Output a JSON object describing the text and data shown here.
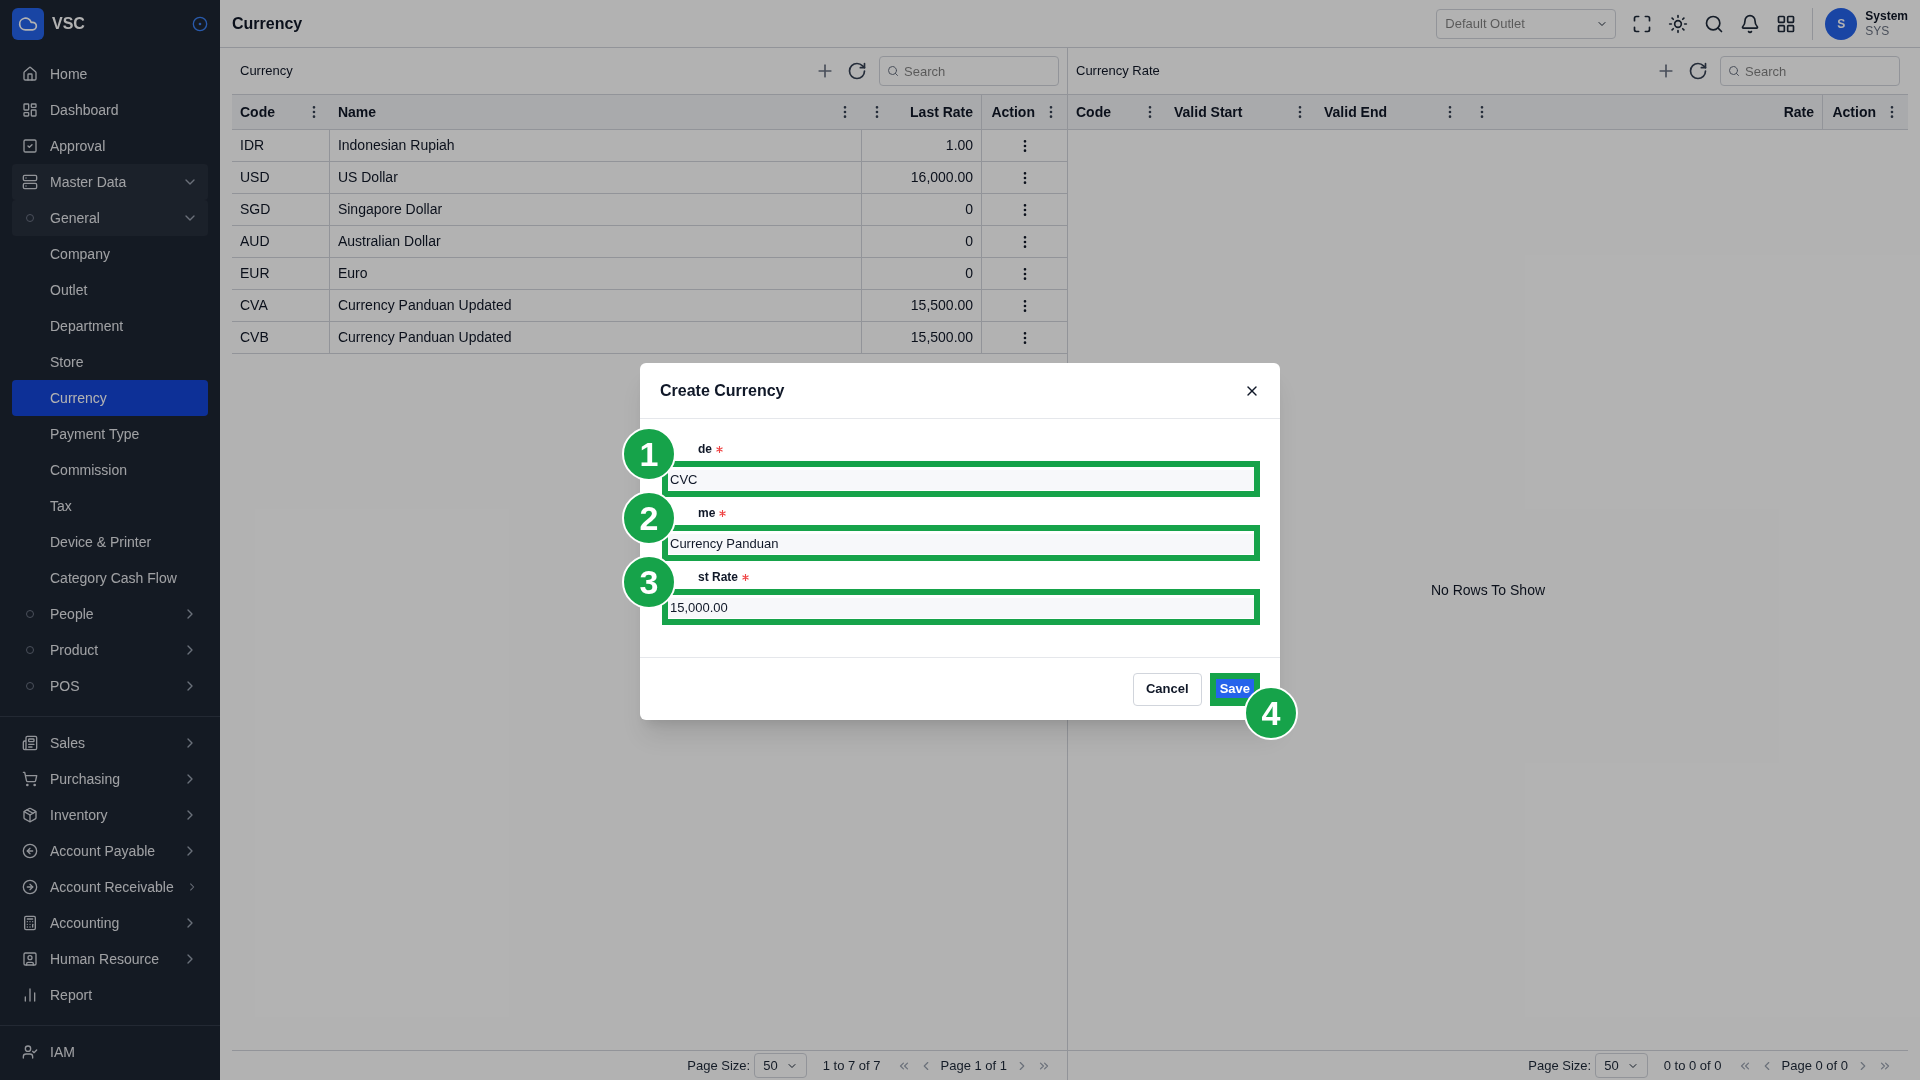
{
  "sidebar": {
    "brand": "VSC",
    "sections": [
      [
        {
          "label": "Home",
          "selected": false
        },
        {
          "label": "Dashboard",
          "selected": false
        },
        {
          "label": "Approval",
          "selected": false
        },
        {
          "label": "Master Data",
          "selected": false,
          "expanded": true,
          "children": [
            {
              "label": "General",
              "selected": false,
              "expanded": true,
              "children": [
                {
                  "label": "Company",
                  "selected": false
                },
                {
                  "label": "Outlet",
                  "selected": false
                },
                {
                  "label": "Department",
                  "selected": false
                },
                {
                  "label": "Store",
                  "selected": false
                },
                {
                  "label": "Currency",
                  "selected": true
                },
                {
                  "label": "Payment Type",
                  "selected": false
                },
                {
                  "label": "Commission",
                  "selected": false
                },
                {
                  "label": "Tax",
                  "selected": false
                },
                {
                  "label": "Device & Printer",
                  "selected": false
                },
                {
                  "label": "Category Cash Flow",
                  "selected": false
                }
              ]
            },
            {
              "label": "People",
              "selected": false,
              "expanded": false
            },
            {
              "label": "Product",
              "selected": false,
              "expanded": false
            },
            {
              "label": "POS",
              "selected": false,
              "expanded": false
            }
          ]
        }
      ],
      [
        {
          "label": "Sales",
          "selected": false,
          "expanded": false
        },
        {
          "label": "Purchasing",
          "selected": false,
          "expanded": false
        },
        {
          "label": "Inventory",
          "selected": false,
          "expanded": false
        },
        {
          "label": "Account Payable",
          "selected": false,
          "expanded": false
        },
        {
          "label": "Account Receivable",
          "selected": false,
          "expanded": false
        },
        {
          "label": "Accounting",
          "selected": false,
          "expanded": false
        },
        {
          "label": "Human Resource",
          "selected": false,
          "expanded": false
        },
        {
          "label": "Report",
          "selected": false
        }
      ],
      [
        {
          "label": "IAM",
          "selected": false
        }
      ]
    ]
  },
  "topbar": {
    "title": "Currency",
    "outlet_select": {
      "placeholder": "Default Outlet"
    },
    "user": {
      "initial": "S",
      "name": "System",
      "code": "SYS"
    }
  },
  "currency_panel": {
    "title": "Currency",
    "search": {
      "placeholder": "Search"
    },
    "columns": [
      "Code",
      "Name",
      "Last Rate",
      "Action"
    ],
    "rows": [
      [
        "IDR",
        "Indonesian Rupiah",
        "1.00"
      ],
      [
        "USD",
        "US Dollar",
        "16,000.00"
      ],
      [
        "SGD",
        "Singapore Dollar",
        "0"
      ],
      [
        "AUD",
        "Australian Dollar",
        "0"
      ],
      [
        "EUR",
        "Euro",
        "0"
      ],
      [
        "CVA",
        "Currency Panduan Updated",
        "15,500.00"
      ],
      [
        "CVB",
        "Currency Panduan Updated",
        "15,500.00"
      ]
    ],
    "footer": {
      "page_size_label": "Page Size:",
      "page_size": "50",
      "range": "1 to 7 of 7",
      "page": "Page 1 of 1"
    }
  },
  "rate_panel": {
    "title": "Currency Rate",
    "search": {
      "placeholder": "Search"
    },
    "columns": [
      "Code",
      "Valid Start",
      "Valid End",
      "Rate",
      "Action"
    ],
    "empty": "No Rows To Show",
    "footer": {
      "page_size_label": "Page Size:",
      "page_size": "50",
      "range": "0 to 0 of 0",
      "page": "Page 0 of 0"
    }
  },
  "dialog": {
    "title": "Create Currency",
    "fields": [
      {
        "label": "de",
        "required": true,
        "value": "CVC",
        "step": "1"
      },
      {
        "label": "me",
        "required": true,
        "value": "Currency Panduan",
        "step": "2"
      },
      {
        "label": "st Rate",
        "required": true,
        "value": "15,000.00",
        "step": "3"
      }
    ],
    "cancel": "Cancel",
    "save": {
      "label": "Save",
      "step": "4"
    }
  }
}
